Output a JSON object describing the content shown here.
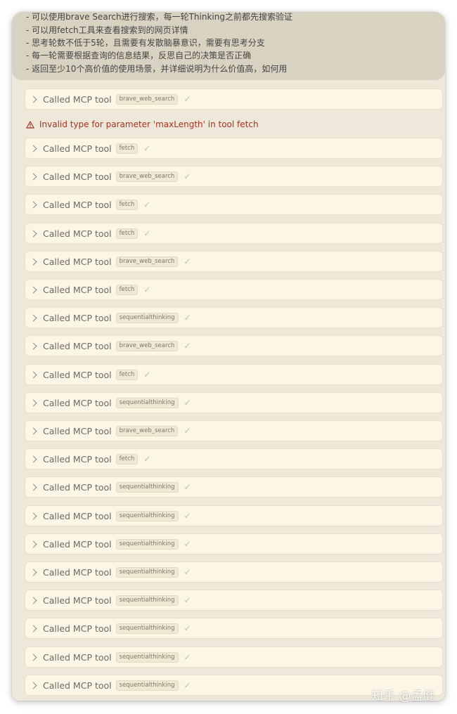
{
  "user_message": {
    "lines": [
      "- 可以使用brave Search进行搜索，每一轮Thinking之前都先搜索验证",
      "- 可以用fetch工具来查看搜索到的网页详情",
      "- 思考轮数不低于5轮，且需要有发散脑暴意识，需要有思考分支",
      "- 每一轮需要根据查询的信息结果，反思自己的决策是否正确",
      "- 返回至少10个高价值的使用场景，并详细说明为什么价值高，如何用"
    ]
  },
  "called_label": "Called MCP tool",
  "error_message": "Invalid type for parameter 'maxLength' in tool fetch",
  "tool_calls_before_error": [
    {
      "tool": "brave_web_search",
      "status": "success"
    }
  ],
  "tool_calls": [
    {
      "tool": "fetch",
      "status": "success"
    },
    {
      "tool": "brave_web_search",
      "status": "success"
    },
    {
      "tool": "fetch",
      "status": "success"
    },
    {
      "tool": "fetch",
      "status": "success"
    },
    {
      "tool": "brave_web_search",
      "status": "success"
    },
    {
      "tool": "fetch",
      "status": "success"
    },
    {
      "tool": "sequentialthinking",
      "status": "success"
    },
    {
      "tool": "brave_web_search",
      "status": "success"
    },
    {
      "tool": "fetch",
      "status": "success"
    },
    {
      "tool": "sequentialthinking",
      "status": "success"
    },
    {
      "tool": "brave_web_search",
      "status": "success"
    },
    {
      "tool": "fetch",
      "status": "success"
    },
    {
      "tool": "sequentialthinking",
      "status": "success"
    },
    {
      "tool": "sequentialthinking",
      "status": "success"
    },
    {
      "tool": "sequentialthinking",
      "status": "success"
    },
    {
      "tool": "sequentialthinking",
      "status": "success"
    },
    {
      "tool": "sequentialthinking",
      "status": "success"
    },
    {
      "tool": "sequentialthinking",
      "status": "success"
    },
    {
      "tool": "sequentialthinking",
      "status": "success"
    },
    {
      "tool": "sequentialthinking",
      "status": "success"
    }
  ],
  "watermark": "知乎 @孟健",
  "colors": {
    "error": "#a8321f",
    "success_check": "#a9cf9a",
    "panel_bg": "#ede8da",
    "row_bg": "#fcf6e6"
  }
}
